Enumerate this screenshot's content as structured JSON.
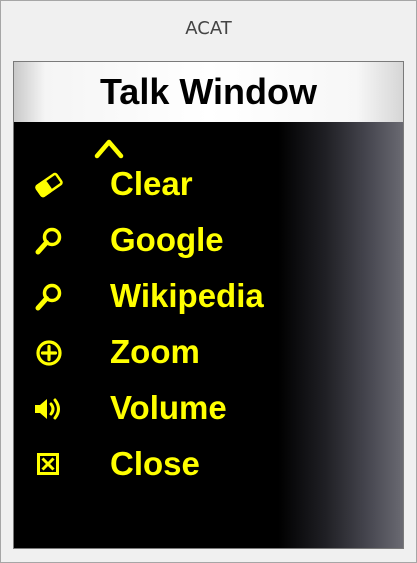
{
  "window": {
    "title": "ACAT"
  },
  "panel": {
    "title": "Talk Window",
    "scroll_up_icon": "chevron-up-icon",
    "items": [
      {
        "label": "Clear",
        "icon": "eraser-icon"
      },
      {
        "label": "Google",
        "icon": "search-icon"
      },
      {
        "label": "Wikipedia",
        "icon": "search-icon"
      },
      {
        "label": "Zoom",
        "icon": "zoom-plus-icon"
      },
      {
        "label": "Volume",
        "icon": "speaker-icon"
      },
      {
        "label": "Close",
        "icon": "close-box-icon"
      }
    ]
  },
  "colors": {
    "item_text": "#ffff00",
    "panel_background": "#000000",
    "title_text": "#000000"
  }
}
